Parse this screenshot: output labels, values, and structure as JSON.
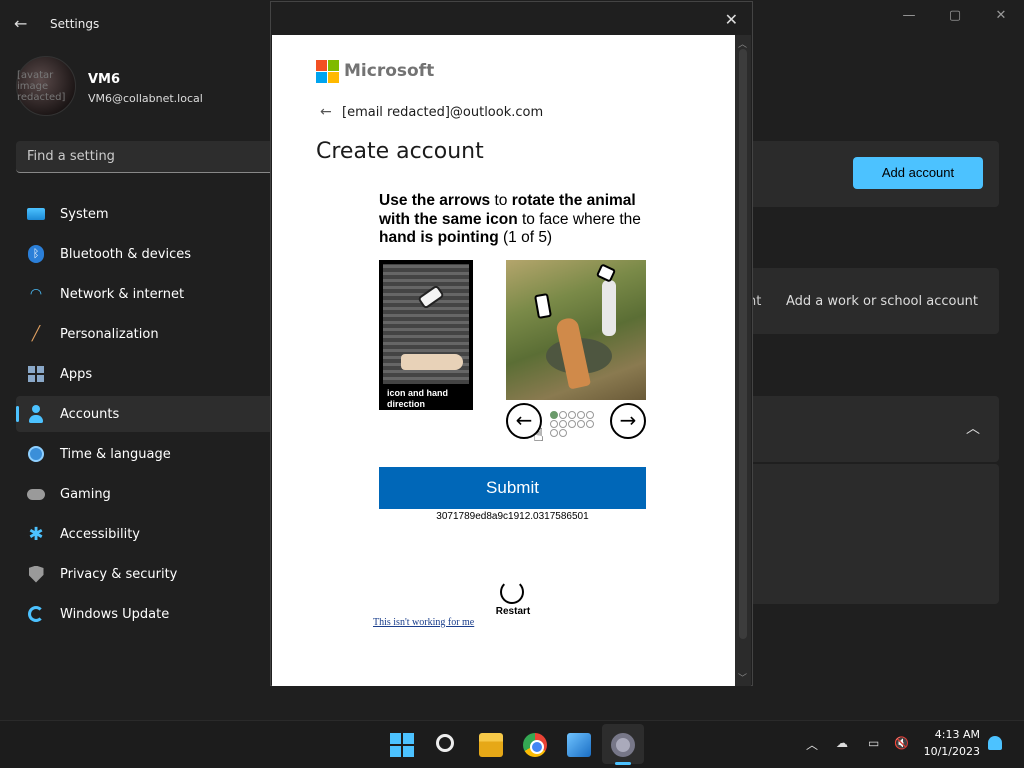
{
  "window": {
    "title": "Settings",
    "minimize": "—",
    "maximize": "▢",
    "close": "✕"
  },
  "profile": {
    "name": "VM6",
    "email": "VM6@collabnet.local",
    "avatar_note": "[avatar image redacted]"
  },
  "search": {
    "placeholder": "Find a setting"
  },
  "sidebar": {
    "items": [
      {
        "label": "System",
        "icon": "system-icon"
      },
      {
        "label": "Bluetooth & devices",
        "icon": "bluetooth-icon"
      },
      {
        "label": "Network & internet",
        "icon": "wifi-icon"
      },
      {
        "label": "Personalization",
        "icon": "brush-icon"
      },
      {
        "label": "Apps",
        "icon": "apps-icon"
      },
      {
        "label": "Accounts",
        "icon": "person-icon",
        "active": true
      },
      {
        "label": "Time & language",
        "icon": "globe-icon"
      },
      {
        "label": "Gaming",
        "icon": "gamepad-icon"
      },
      {
        "label": "Accessibility",
        "icon": "accessibility-icon"
      },
      {
        "label": "Privacy & security",
        "icon": "shield-icon"
      },
      {
        "label": "Windows Update",
        "icon": "update-icon"
      }
    ]
  },
  "main": {
    "add_account": "Add account",
    "work_school_partial": "nt",
    "add_work_school": "Add a work or school account"
  },
  "dialog": {
    "brand": "Microsoft",
    "email": "[email redacted]@outlook.com",
    "heading": "Create account",
    "instr": {
      "a": "Use the arrows",
      "b": " to ",
      "c": "rotate the animal with the same icon",
      "d": " to face where the ",
      "e": "hand is pointing",
      "f": " (1 of 5)"
    },
    "ref_caption": "icon and hand direction",
    "left_arrow": "←",
    "right_arrow": "→",
    "submit": "Submit",
    "session_id": "3071789ed8a9c1912.0317586501",
    "restart": "Restart",
    "help_link": "This isn't working for me"
  },
  "taskbar": {
    "apps": [
      "start-icon",
      "search-icon",
      "file-explorer-icon",
      "chrome-icon",
      "photos-icon",
      "settings-icon"
    ],
    "time": "4:13 AM",
    "date": "10/1/2023"
  },
  "colors": {
    "accent": "#4cc2ff",
    "submit_blue": "#0067b8"
  }
}
